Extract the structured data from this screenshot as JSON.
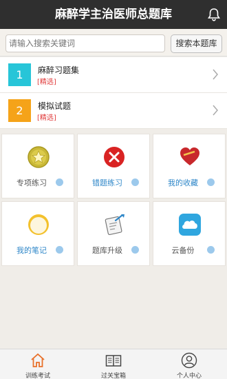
{
  "header": {
    "title": "麻醉学主治医师总题库"
  },
  "search": {
    "placeholder": "请输入搜索关键词",
    "button_label": "搜索本题库"
  },
  "list": [
    {
      "number": "1",
      "label": "麻醉习题集",
      "tag": "[精选]",
      "color": "#27c5d8"
    },
    {
      "number": "2",
      "label": "模拟试题",
      "tag": "[精选]",
      "color": "#f5a319"
    }
  ],
  "grid": [
    {
      "label": "专项练习",
      "icon": "star-medal-icon",
      "color": "#555555"
    },
    {
      "label": "错题练习",
      "icon": "red-cross-icon",
      "color": "#2d86c8"
    },
    {
      "label": "我的收藏",
      "icon": "heart-icon",
      "color": "#2d86c8"
    },
    {
      "label": "我的笔记",
      "icon": "notes-circle-icon",
      "color": "#2d86c8"
    },
    {
      "label": "题库升级",
      "icon": "upgrade-clipboard-icon",
      "color": "#555555"
    },
    {
      "label": "云备份",
      "icon": "cloud-backup-icon",
      "color": "#555555"
    }
  ],
  "tabs": [
    {
      "label": "训练考试",
      "icon": "home-icon"
    },
    {
      "label": "过关宝箱",
      "icon": "book-icon"
    },
    {
      "label": "个人中心",
      "icon": "user-icon"
    }
  ]
}
